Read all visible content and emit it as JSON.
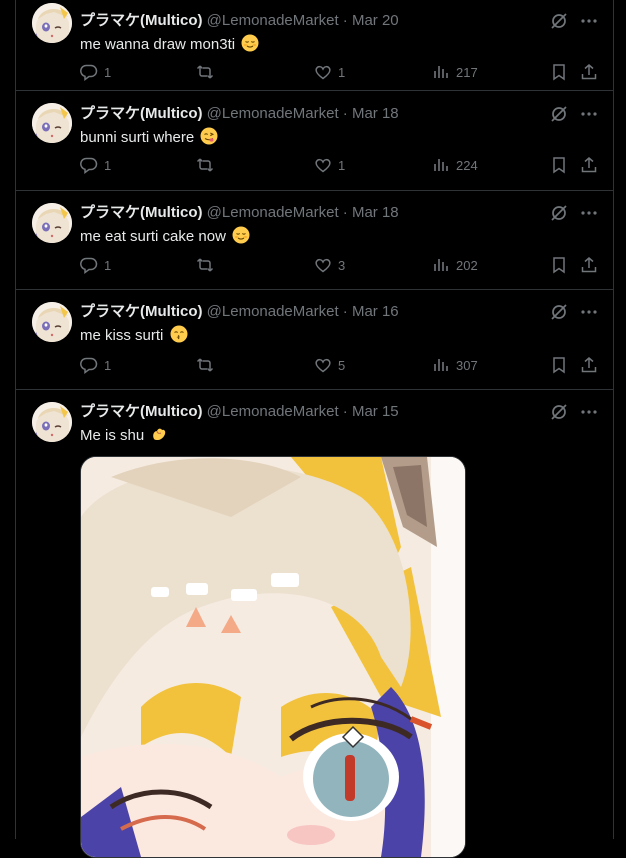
{
  "author": {
    "display_name": "プラマケ(Multico)",
    "handle": "@LemonadeMarket"
  },
  "separator": "·",
  "tweets": [
    {
      "date": "Mar 20",
      "text": "me wanna draw mon3ti",
      "emoji": "relieved-face",
      "replies": "1",
      "likes": "1",
      "views": "217"
    },
    {
      "date": "Mar 18",
      "text": "bunni surti where",
      "emoji": "face-savoring-food",
      "replies": "1",
      "likes": "1",
      "views": "224"
    },
    {
      "date": "Mar 18",
      "text": "me eat surti cake now",
      "emoji": "relieved-face",
      "replies": "1",
      "likes": "3",
      "views": "202"
    },
    {
      "date": "Mar 16",
      "text": "me kiss surti",
      "emoji": "kissing-face-smiling-eyes",
      "replies": "1",
      "likes": "5",
      "views": "307"
    },
    {
      "date": "Mar 15",
      "text": "Me is shu",
      "emoji": "pinching-hand",
      "image": "anime-character-closeup"
    }
  ],
  "colors": {
    "background": "#000000",
    "text": "#e7e9ea",
    "muted": "#71767b",
    "divider": "#2f3336"
  }
}
